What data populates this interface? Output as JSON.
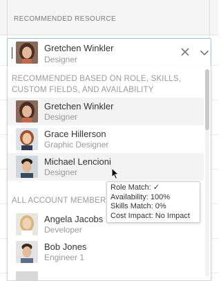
{
  "column": {
    "title": "RECOMMENDED RESOURCE"
  },
  "field": {
    "selected_name": "Gretchen Winkler",
    "selected_role": "Designer"
  },
  "menu": {
    "recommended_header": "RECOMMENDED BASED ON ROLE, SKILLS, CUSTOM FIELDS, AND AVAILABILITY",
    "recommended": [
      {
        "name": "Gretchen Winkler",
        "role": "Designer"
      },
      {
        "name": "Grace Hillerson",
        "role": "Graphic Designer"
      },
      {
        "name": "Michael Lencioni",
        "role": "Designer"
      }
    ],
    "all_header": "ALL ACCOUNT MEMBERS",
    "all": [
      {
        "name": "Angela Jacobs",
        "role": "Developer"
      },
      {
        "name": "Bob Jones",
        "role": "Engineer 1"
      }
    ]
  },
  "tooltip": {
    "role_match": "Role Match: ✓",
    "availability": "Availability: 100%",
    "skills_match": "Skills Match: 0%",
    "cost_impact": "Cost Impact: No Impact"
  },
  "colors": {
    "focus_border": "#9cc3e3",
    "muted_text": "#9a9a9a",
    "selected_bg": "#f3f3f3"
  },
  "icons": [
    "clear-icon",
    "chevron-down-icon",
    "mouse-pointer-icon"
  ]
}
